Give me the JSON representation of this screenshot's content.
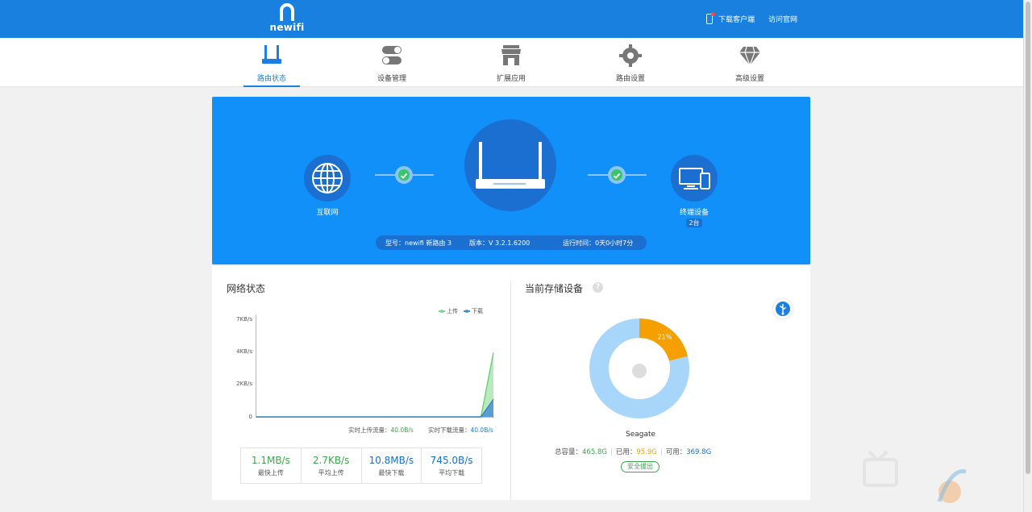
{
  "brand": {
    "name": "newifi"
  },
  "toplinks": {
    "download_client": "下载客户端",
    "visit_site": "访问官网"
  },
  "nav": [
    {
      "label": "路由状态",
      "icon": "router-icon",
      "active": true
    },
    {
      "label": "设备管理",
      "icon": "toggle-icon",
      "active": false
    },
    {
      "label": "扩展应用",
      "icon": "store-icon",
      "active": false
    },
    {
      "label": "路由设置",
      "icon": "gear-icon",
      "active": false
    },
    {
      "label": "高级设置",
      "icon": "diamond-icon",
      "active": false
    }
  ],
  "topology": {
    "internet_label": "互联网",
    "terminal_label": "终端设备",
    "terminal_count": "2台",
    "model": "型号：newifi 新路由 3",
    "version": "版本：V 3.2.1.6200",
    "uptime": "运行时间：0天0小时7分"
  },
  "network": {
    "title": "网络状态",
    "legend_upload": "上传",
    "legend_download": "下载",
    "realtime_upload_label": "实时上传流量：",
    "realtime_upload_value": "40.0B/s",
    "realtime_download_label": "实时下载流量：",
    "realtime_download_value": "40.0B/s",
    "stats": [
      {
        "value": "1.1MB/s",
        "label": "最快上传"
      },
      {
        "value": "2.7KB/s",
        "label": "平均上传"
      },
      {
        "value": "10.8MB/s",
        "label": "最快下载"
      },
      {
        "value": "745.0B/s",
        "label": "平均下载"
      }
    ]
  },
  "chart_data": {
    "type": "area",
    "yticks": [
      "7KB/s",
      "4KB/s",
      "2KB/s",
      "0"
    ],
    "ylim": [
      0,
      7
    ],
    "x": [
      0,
      1,
      2,
      3,
      4,
      5,
      6,
      7,
      8,
      9,
      10,
      11,
      12,
      13,
      14,
      15,
      16,
      17,
      18,
      19
    ],
    "series": [
      {
        "name": "上传",
        "color": "#7fd88a",
        "values": [
          0,
          0,
          0,
          0,
          0,
          0,
          0,
          0,
          0,
          0,
          0,
          0,
          0,
          0,
          0,
          0,
          0,
          0,
          0,
          4.4
        ]
      },
      {
        "name": "下载",
        "color": "#4a8fd0",
        "values": [
          0,
          0,
          0,
          0,
          0,
          0,
          0,
          0,
          0,
          0,
          0,
          0,
          0,
          0,
          0,
          0,
          0,
          0,
          0,
          1.2
        ]
      }
    ],
    "grid": false
  },
  "storage": {
    "title": "当前存储设备",
    "help": "?",
    "disk_name": "Seagate",
    "used_percent": 21,
    "used_percent_label": "21%",
    "total_label": "总容量：",
    "total_value": "465.8G",
    "used_label": "已用：",
    "used_value": "95.9G",
    "free_label": "可用：",
    "free_value": "369.8G",
    "eject": "安全拔出",
    "colors": {
      "used": "#f5a000",
      "free": "#a8d6fb"
    }
  }
}
